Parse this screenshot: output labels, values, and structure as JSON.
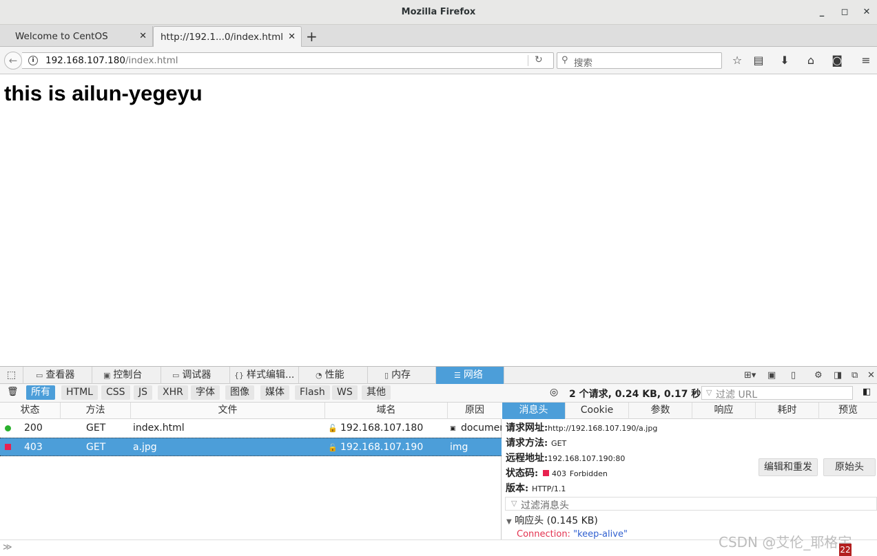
{
  "window": {
    "title": "Mozilla Firefox"
  },
  "tabs": [
    {
      "label": "Welcome to CentOS"
    },
    {
      "label": "http://192.1...0/index.html"
    }
  ],
  "urlbar": {
    "host": "192.168.107.180",
    "path": "/index.html"
  },
  "search": {
    "placeholder": "搜索"
  },
  "page": {
    "heading": "this is ailun-yegeyu"
  },
  "devtools": {
    "tabs": [
      "查看器",
      "控制台",
      "调试器",
      "样式编辑...",
      "性能",
      "内存",
      "网络"
    ],
    "filters": [
      "所有",
      "HTML",
      "CSS",
      "JS",
      "XHR",
      "字体",
      "图像",
      "媒体",
      "Flash",
      "WS",
      "其他"
    ],
    "summary": "2 个请求, 0.24 KB, 0.17 秒",
    "url_filter_placeholder": "过滤 URL",
    "columns": [
      "状态",
      "方法",
      "文件",
      "域名",
      "原因"
    ],
    "requests": [
      {
        "status": "200",
        "method": "GET",
        "file": "index.html",
        "domain": "192.168.107.180",
        "cause": "documen",
        "status_color": "#2bb12e"
      },
      {
        "status": "403",
        "method": "GET",
        "file": "a.jpg",
        "domain": "192.168.107.190",
        "cause": "img",
        "status_color": "#e8214f"
      }
    ],
    "detail_tabs": [
      "消息头",
      "Cookie",
      "参数",
      "响应",
      "耗时",
      "预览"
    ],
    "headers": {
      "url_label": "请求网址:",
      "url_value": "http://192.168.107.190/a.jpg",
      "method_label": "请求方法:",
      "method_value": "GET",
      "remote_label": "远程地址:",
      "remote_value": "192.168.107.190:80",
      "status_label": "状态码:",
      "status_code": "403",
      "status_text": "Forbidden",
      "version_label": "版本:",
      "version_value": "HTTP/1.1"
    },
    "buttons": {
      "edit_resend": "编辑和重发",
      "raw_headers": "原始头"
    },
    "header_filter_placeholder": "过滤消息头",
    "response_headers": {
      "label": "响应头",
      "size": "(0.145 KB)"
    },
    "connection": {
      "key": "Connection:",
      "value": "\"keep-alive\""
    }
  },
  "watermark": "CSDN @艾伦_耶格宇",
  "badge": "22"
}
